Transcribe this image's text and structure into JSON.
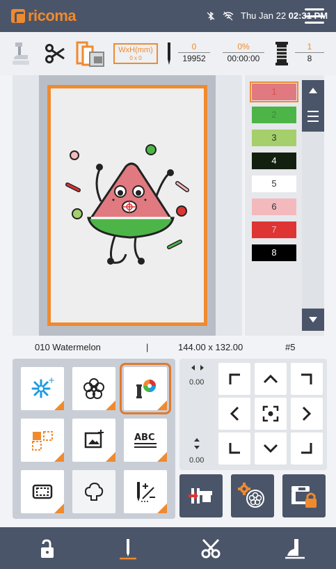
{
  "app": {
    "logo": "ricoma"
  },
  "status": {
    "day_date": "Thu Jan 22",
    "time": "02:31 PM"
  },
  "toolbar": {
    "size_label": "WxH(mm)",
    "size_value": "0 x 0",
    "stitch_current": "0",
    "stitch_total": "19952",
    "progress_percent": "0%",
    "progress_time": "00:00:00",
    "color_current": "1",
    "color_total": "8"
  },
  "colors": [
    {
      "label": "1",
      "hex": "#e07a80",
      "text": "#d8504f"
    },
    {
      "label": "2",
      "hex": "#4db548",
      "text": "#3b8a36"
    },
    {
      "label": "3",
      "hex": "#a5cf6a",
      "text": "#333333"
    },
    {
      "label": "4",
      "hex": "#13200f",
      "text": "#ffffff"
    },
    {
      "label": "5",
      "hex": "#ffffff",
      "text": "#333333"
    },
    {
      "label": "6",
      "hex": "#f4b9bd",
      "text": "#333333"
    },
    {
      "label": "7",
      "hex": "#de3434",
      "text": "#f4b9bd"
    },
    {
      "label": "8",
      "hex": "#000000",
      "text": "#ffffff"
    }
  ],
  "design": {
    "name": "010 Watermelon",
    "separator": "|",
    "dimensions": "144.00 x 132.00",
    "slot": "#5"
  },
  "move": {
    "x_value": "0.00",
    "y_value": "0.00"
  },
  "accent": "#f08a2e",
  "bar_color": "#4b5569"
}
